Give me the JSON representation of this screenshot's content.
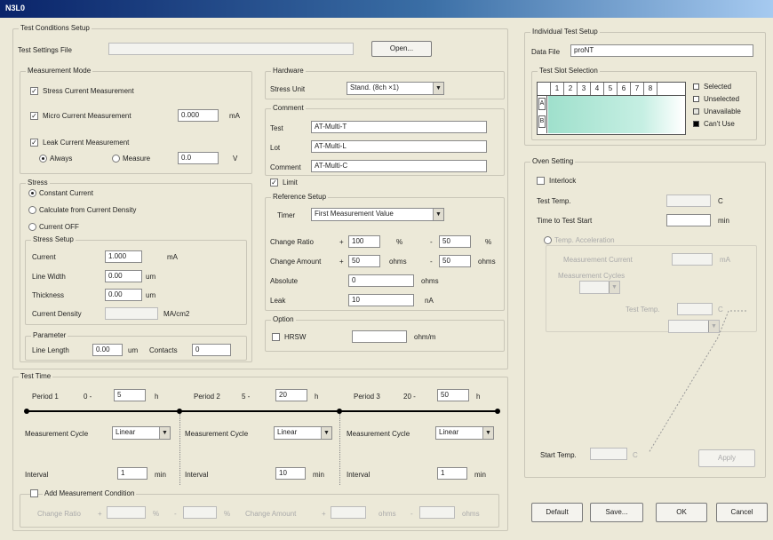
{
  "window": {
    "title": "N3L0"
  },
  "test_conditions": {
    "title": "Test Conditions Setup",
    "settings_file_label": "Test Settings File",
    "settings_file_value": "",
    "open_button": "Open...",
    "measurement_mode": {
      "title": "Measurement Mode",
      "stress_current": "Stress Current Measurement",
      "micro_current": "Micro Current Measurement",
      "micro_value": "0.000",
      "micro_unit": "mA",
      "leak_current": "Leak Current Measurement",
      "always": "Always",
      "measure": "Measure",
      "leak_value": "0.0",
      "leak_unit": "V"
    },
    "stress": {
      "title": "Stress",
      "constant_current": "Constant Current",
      "calculate": "Calculate from Current Density",
      "current_off": "Current OFF",
      "setup_title": "Stress Setup",
      "current_label": "Current",
      "current_value": "1.000",
      "current_unit": "mA",
      "line_width_label": "Line Width",
      "line_width_value": "0.00",
      "line_width_unit": "um",
      "thickness_label": "Thickness",
      "thickness_value": "0.00",
      "thickness_unit": "um",
      "density_label": "Current Density",
      "density_value": "",
      "density_unit": "MA/cm2",
      "parameter_title": "Parameter",
      "line_length_label": "Line Length",
      "line_length_value": "0.00",
      "line_length_unit": "um",
      "contacts_label": "Contacts",
      "contacts_value": "0"
    },
    "hardware": {
      "title": "Hardware",
      "stress_unit_label": "Stress Unit",
      "stress_unit_value": "Stand. (8ch ×1)"
    },
    "comment": {
      "title": "Comment",
      "test_label": "Test",
      "test_value": "AT-Multi-T",
      "lot_label": "Lot",
      "lot_value": "AT-Multi-L",
      "comment_label": "Comment",
      "comment_value": "AT-Multi-C"
    },
    "limit": {
      "checkbox": "Limit",
      "ref_title": "Reference Setup",
      "timer_label": "Timer",
      "timer_value": "First Measurement Value",
      "change_ratio_label": "Change Ratio",
      "change_ratio_plus": "100",
      "change_ratio_minus": "50",
      "pct": "%",
      "change_amount_label": "Change Amount",
      "change_amount_plus": "50",
      "change_amount_minus": "50",
      "ohms": "ohms",
      "absolute_label": "Absolute",
      "absolute_value": "0",
      "leak_label": "Leak",
      "leak_value": "10",
      "leak_unit": "nA",
      "plus": "+",
      "minus": "-"
    },
    "option": {
      "title": "Option",
      "hrsw": "HRSW",
      "hrsw_value": "",
      "hrsw_unit": "ohm/m"
    }
  },
  "test_time": {
    "title": "Test Time",
    "periods": [
      {
        "label": "Period 1",
        "range": "0 -",
        "value": "5",
        "unit": "h"
      },
      {
        "label": "Period 2",
        "range": "5 -",
        "value": "20",
        "unit": "h"
      },
      {
        "label": "Period 3",
        "range": "20 -",
        "value": "50",
        "unit": "h"
      }
    ],
    "cycles": [
      {
        "label": "Measurement Cycle",
        "value": "Linear"
      },
      {
        "label": "Measurement Cycle",
        "value": "Linear"
      },
      {
        "label": "Measurement Cycle",
        "value": "Linear"
      }
    ],
    "intervals": [
      {
        "label": "Interval",
        "value": "1",
        "unit": "min"
      },
      {
        "label": "Interval",
        "value": "10",
        "unit": "min"
      },
      {
        "label": "Interval",
        "value": "1",
        "unit": "min"
      }
    ],
    "add_condition": "Add Measurement Condition",
    "cr_label": "Change Ratio",
    "cr_plus": "",
    "cr_minus": "",
    "ca_label": "Change Amount",
    "ca_plus": "",
    "ca_minus": "",
    "pct": "%",
    "ohms": "ohms",
    "plus": "+",
    "minus": "-"
  },
  "individual": {
    "title": "Individual Test Setup",
    "data_file_label": "Data File",
    "data_file_value": "proNT",
    "slot_title": "Test Slot Selection",
    "slots": [
      "1",
      "2",
      "3",
      "4",
      "5",
      "6",
      "7",
      "8"
    ],
    "rows": [
      "A",
      "B"
    ],
    "legend": [
      "Selected",
      "Unselected",
      "Unavailable",
      "Can't Use"
    ],
    "legend_colors": [
      "#ffffff",
      "#ffffff",
      "#e6e6e0",
      "#000000"
    ]
  },
  "oven": {
    "title": "Oven Setting",
    "interlock": "Interlock",
    "test_temp_label": "Test Temp.",
    "test_temp_value": "",
    "test_temp_unit": "C",
    "time_label": "Time to Test Start",
    "time_value": "",
    "time_unit": "min",
    "temp_accel": "Temp. Acceleration",
    "meas_current_label": "Measurement Current",
    "meas_current_value": "",
    "meas_current_unit": "mA",
    "meas_cycles_label": "Measurement Cycles",
    "test_temp2_label": "Test Temp.",
    "test_temp2_unit": "C",
    "start_temp_label": "Start Temp.",
    "start_temp_unit": "C",
    "apply_button": "Apply"
  },
  "buttons": {
    "default": "Default",
    "save": "Save...",
    "ok": "OK",
    "cancel": "Cancel"
  }
}
